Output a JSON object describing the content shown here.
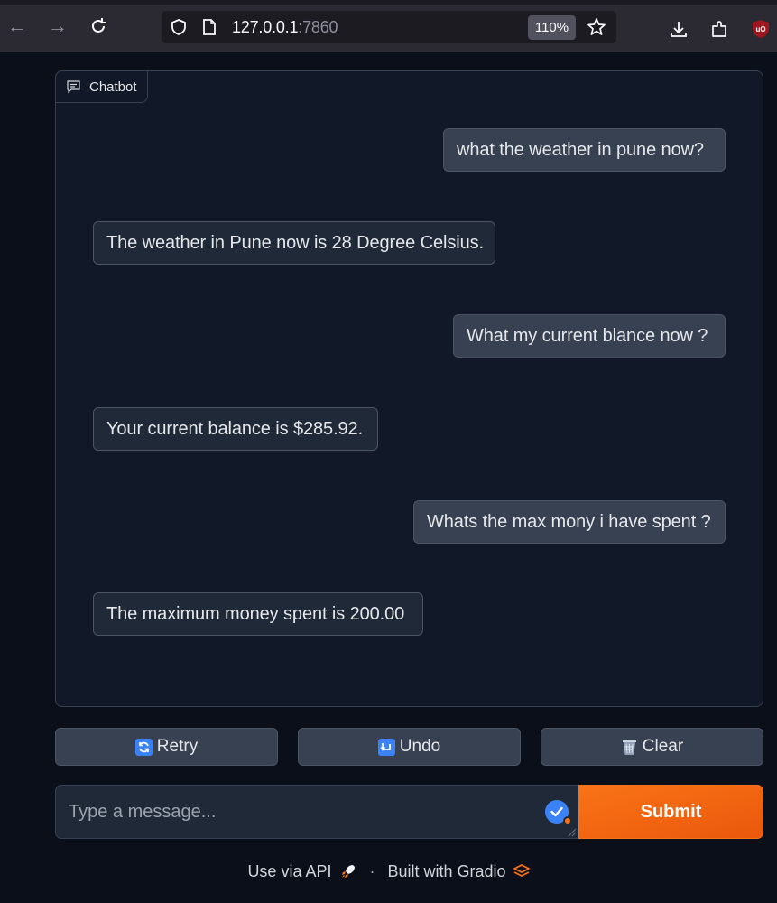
{
  "browser": {
    "url_host": "127.0.0.1",
    "url_port": ":7860",
    "zoom": "110%"
  },
  "chatbot": {
    "label": "Chatbot",
    "messages": [
      {
        "role": "user",
        "text": "what the weather in pune now?"
      },
      {
        "role": "bot",
        "text": "The weather in Pune now is 28 Degree Celsius."
      },
      {
        "role": "user",
        "text": "What my current blance now ?"
      },
      {
        "role": "bot",
        "text": "Your current balance is $285.92."
      },
      {
        "role": "user",
        "text": "Whats the max mony i have spent ?"
      },
      {
        "role": "bot",
        "text": "The maximum money spent is 200.00"
      }
    ]
  },
  "actions": {
    "retry": "Retry",
    "undo": "Undo",
    "clear": "Clear"
  },
  "input": {
    "placeholder": "Type a message...",
    "submit": "Submit"
  },
  "footer": {
    "api": "Use via API",
    "separator": "·",
    "built": "Built with Gradio"
  },
  "colors": {
    "background": "#0b0f19",
    "panel": "#111827",
    "accent": "#f97316"
  }
}
